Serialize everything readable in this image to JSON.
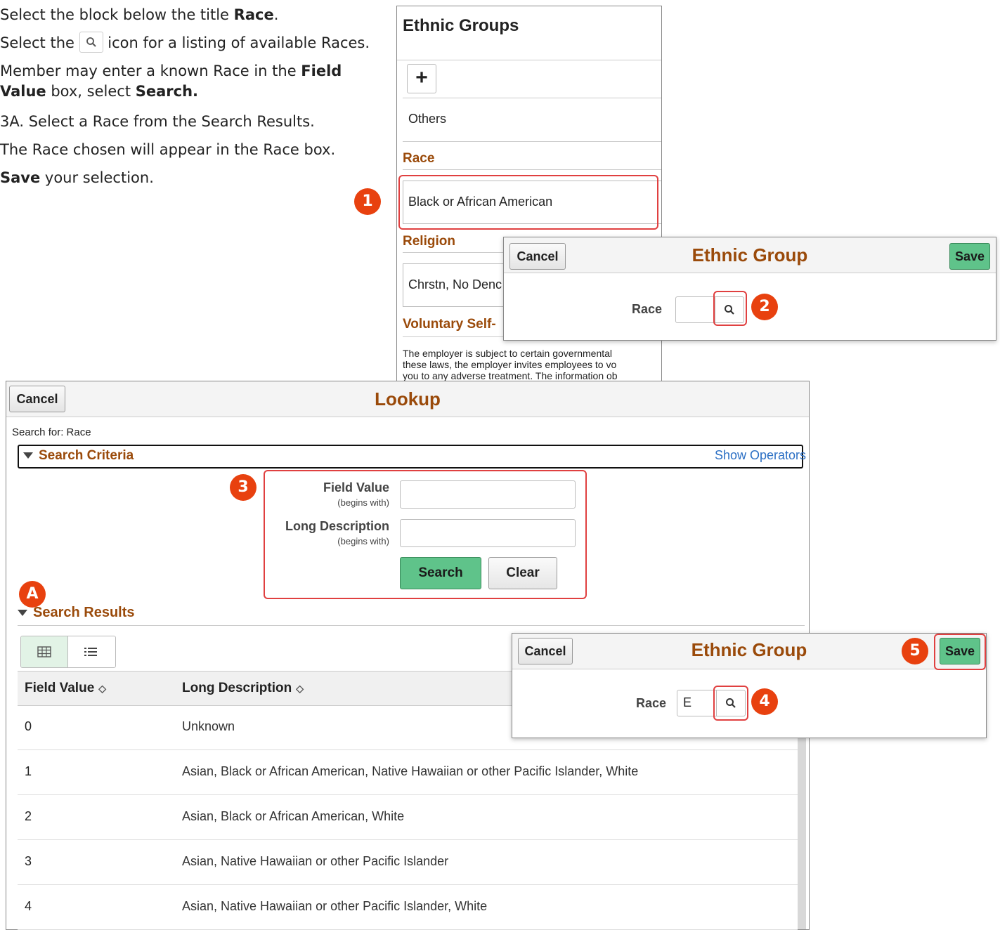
{
  "instructions": {
    "step1_prefix": "Select the block below the title ",
    "step1_bold": "Race",
    "step1_suffix": ".",
    "step2_prefix": "Select the ",
    "step2_suffix": " icon for a listing of available Races.",
    "step3_a": "Member may enter a known Race in the ",
    "step3_bold1": "Field",
    "step3_bold2": "Value",
    "step3_b": " box, select ",
    "step3_bold3": "Search.",
    "step3a": "3A. Select a Race from the Search Results.",
    "step4": "The Race chosen will appear in the Race box.",
    "step5_bold": "Save",
    "step5_suffix": " your selection."
  },
  "badges": {
    "b1": "1",
    "b2": "2",
    "b3": "3",
    "bA": "A",
    "b4": "4",
    "b5": "5"
  },
  "ethnic_groups_panel": {
    "title": "Ethnic Groups",
    "add_icon": "+",
    "others_text": "Others",
    "race_heading": "Race",
    "race_value": "Black or African American",
    "religion_heading": "Religion",
    "religion_value": "Chrstn, No Denc",
    "voluntary_heading": "Voluntary Self-",
    "voluntary_text_1": "The employer is subject to certain governmental",
    "voluntary_text_2": "these laws, the employer invites employees to vo",
    "voluntary_text_3": "you to any adverse treatment. The information ob"
  },
  "dialog_top": {
    "cancel": "Cancel",
    "title": "Ethnic Group",
    "save": "Save",
    "race_label": "Race",
    "race_value": ""
  },
  "dialog_bottom": {
    "cancel": "Cancel",
    "title": "Ethnic Group",
    "save": "Save",
    "race_label": "Race",
    "race_value": "E"
  },
  "lookup": {
    "cancel": "Cancel",
    "title": "Lookup",
    "search_for": "Search for:  Race",
    "criteria_label": "Search Criteria",
    "show_operators": "Show Operators",
    "field_value_label": "Field Value",
    "field_value_sub": "(begins with)",
    "long_desc_label": "Long Description",
    "long_desc_sub": "(begins with)",
    "search_button": "Search",
    "clear_button": "Clear",
    "results_label": "Search Results",
    "columns": [
      "Field Value",
      "Long Description"
    ],
    "sort_glyph": "◇",
    "rows": [
      {
        "value": "0",
        "desc": "Unknown"
      },
      {
        "value": "1",
        "desc": "Asian, Black or African American, Native Hawaiian or other Pacific Islander, White"
      },
      {
        "value": "2",
        "desc": "Asian, Black or African American, White"
      },
      {
        "value": "3",
        "desc": "Asian, Native Hawaiian or other Pacific Islander"
      },
      {
        "value": "4",
        "desc": "Asian, Native Hawaiian or other Pacific Islander, White"
      }
    ]
  },
  "colors": {
    "badge": "#e8410f",
    "heading_brown": "#9a4a0a",
    "save_green": "#5fc38a",
    "highlight_red": "#e04040",
    "link_blue": "#2b6fc4"
  }
}
